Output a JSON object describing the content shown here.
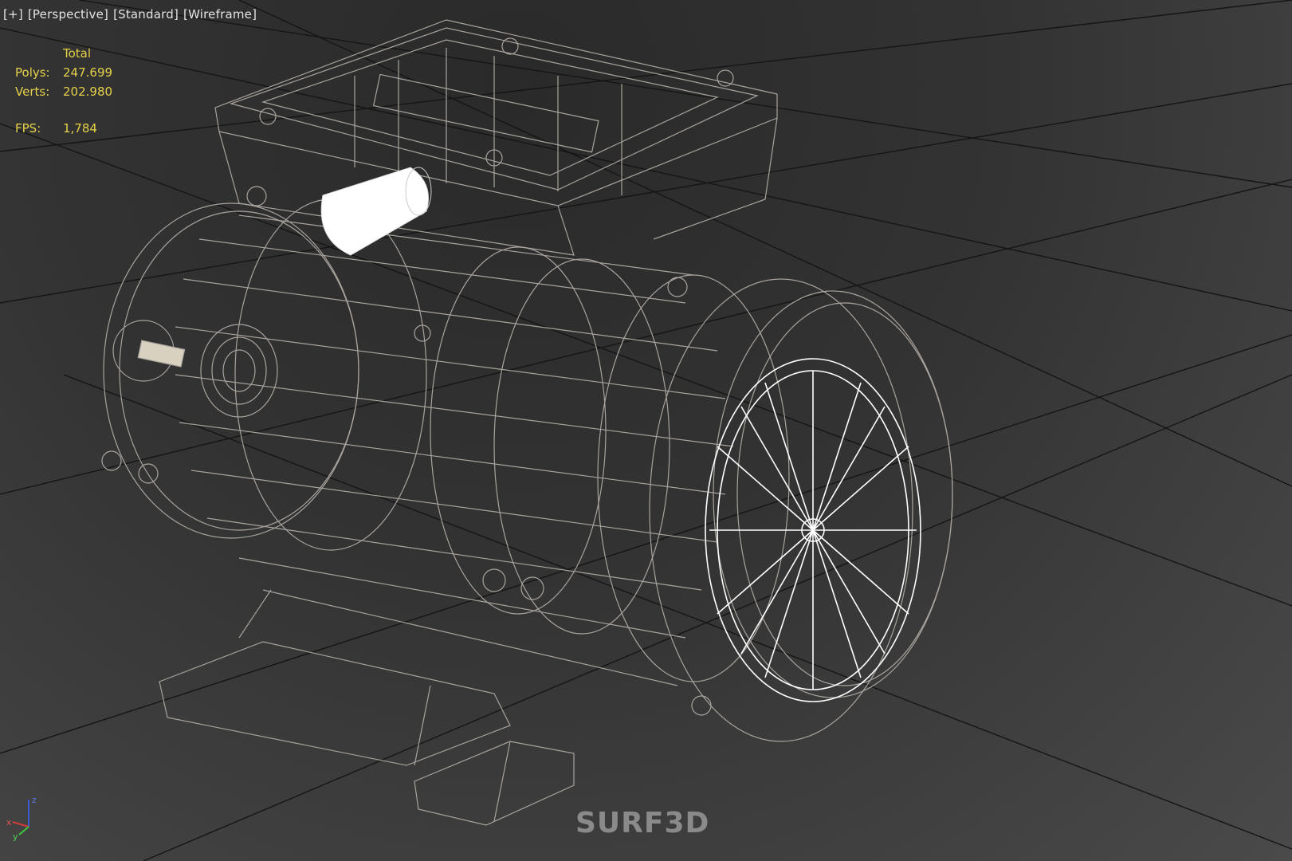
{
  "viewport": {
    "labels": [
      "[+]",
      "[Perspective]",
      "[Standard]",
      "[Wireframe]"
    ],
    "stats": {
      "header": "Total",
      "polys_label": "Polys:",
      "polys_value": "247.699",
      "verts_label": "Verts:",
      "verts_value": "202.980",
      "fps_label": "FPS:",
      "fps_value": "1,784"
    },
    "watermark": "SURF3D",
    "axes": {
      "z": "z",
      "x": "x",
      "y": "y"
    },
    "colors": {
      "grid": "#111111",
      "wire": "#a9a39d",
      "wire_bright": "#ffffff",
      "stats": "#e6d24a",
      "axis_x": "#d23c3c",
      "axis_y": "#3cc83c",
      "axis_z": "#3c5ad2"
    }
  }
}
